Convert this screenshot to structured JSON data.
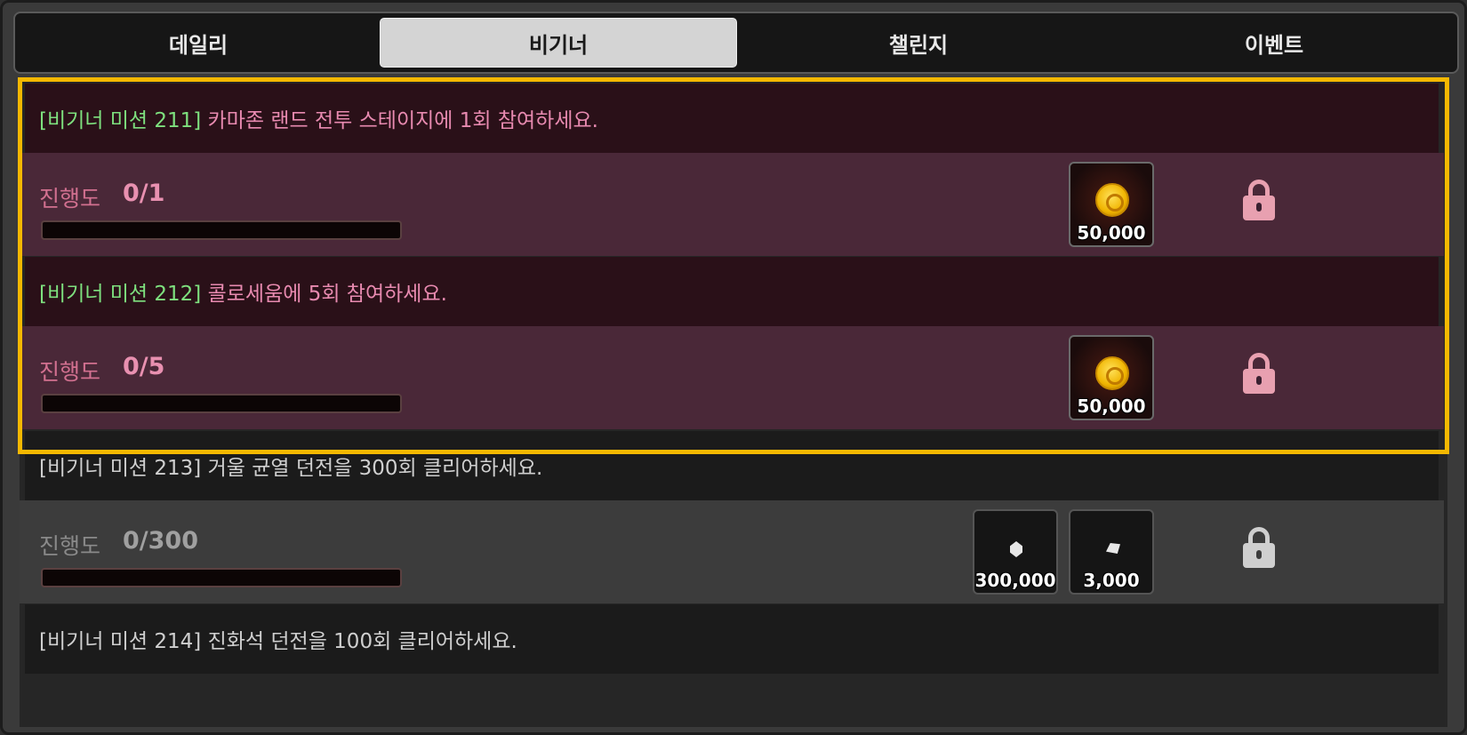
{
  "tabs": [
    {
      "label": "데일리",
      "active": false
    },
    {
      "label": "비기너",
      "active": true
    },
    {
      "label": "챌린지",
      "active": false
    },
    {
      "label": "이벤트",
      "active": false
    }
  ],
  "progress_label": "진행도",
  "missions": [
    {
      "tag": "[비기너 미션 211]",
      "text": "카마존 랜드 전투 스테이지에 1회 참여하세요.",
      "progress": "0/1",
      "progress_fraction": 0,
      "rewards": [
        {
          "icon": "gold-coin-icon",
          "amount": "50,000"
        }
      ],
      "locked": true
    },
    {
      "tag": "[비기너 미션 212]",
      "text": "콜로세움에 5회 참여하세요.",
      "progress": "0/5",
      "progress_fraction": 0,
      "rewards": [
        {
          "icon": "gold-coin-icon",
          "amount": "50,000"
        }
      ],
      "locked": true
    },
    {
      "tag": "[비기너 미션 213]",
      "text": "거울 균열 던전을 300회 클리어하세요.",
      "progress": "0/300",
      "progress_fraction": 0,
      "rewards": [
        {
          "icon": "crystal-icon",
          "amount": "300,000"
        },
        {
          "icon": "stone-icon",
          "amount": "3,000"
        }
      ],
      "locked": true
    },
    {
      "tag": "[비기너 미션 214]",
      "text": "진화석 던전을 100회 클리어하세요."
    }
  ],
  "colors": {
    "highlight": "#f5b800",
    "tag_green": "#7ee07e",
    "pink_text": "#e88ab0"
  }
}
